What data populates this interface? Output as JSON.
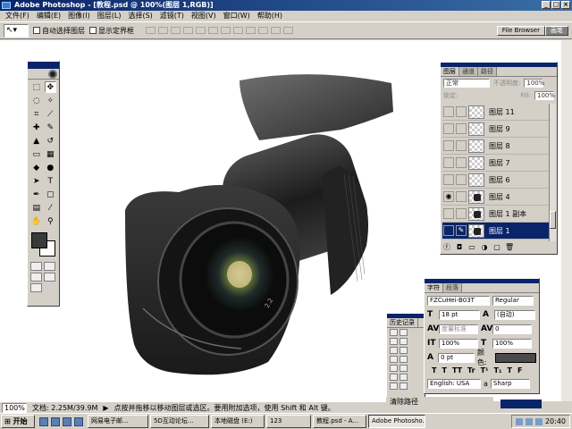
{
  "window": {
    "title": "Adobe Photoshop - [教程.psd @ 100%(图层 1,RGB)]",
    "controls": [
      "_",
      "□",
      "×"
    ]
  },
  "menu": [
    "文件(F)",
    "编辑(E)",
    "图像(I)",
    "图层(L)",
    "选择(S)",
    "滤镜(T)",
    "视图(V)",
    "窗口(W)",
    "帮助(H)"
  ],
  "options": {
    "auto_select": "自动选择图层",
    "show_bounds": "显示定界框"
  },
  "palette_well": [
    "File Browser",
    "画笔"
  ],
  "layers_panel": {
    "tabs": [
      "图层",
      "通道",
      "路径"
    ],
    "blend_mode": "正常",
    "opacity_label": "不透明度:",
    "opacity": "100%",
    "lock_label": "锁定:",
    "fill_label": "Fill:",
    "fill": "100%",
    "layers": [
      {
        "name": "图层 11",
        "thumb": "transparent"
      },
      {
        "name": "图层 9",
        "thumb": "transparent"
      },
      {
        "name": "图层 8",
        "thumb": "transparent"
      },
      {
        "name": "图层 7",
        "thumb": "transparent"
      },
      {
        "name": "图层 6",
        "thumb": "transparent"
      },
      {
        "name": "图层 4",
        "thumb": "object"
      },
      {
        "name": "图层 1 副本",
        "thumb": "object"
      },
      {
        "name": "图层 1",
        "thumb": "object",
        "selected": true
      }
    ]
  },
  "character_panel": {
    "tabs": [
      "字符",
      "段落"
    ],
    "font_family": "FZCuHei-B03T",
    "font_style": "Regular",
    "size": "18 pt",
    "leading": "(自动)",
    "kerning": "度量标准",
    "tracking": "0",
    "vscale": "100%",
    "hscale": "100%",
    "baseline": "0 pt",
    "color_label": "颜色:",
    "styles": [
      "T",
      "T",
      "TT",
      "Tr",
      "T¹",
      "T₁",
      "T",
      "F"
    ],
    "language": "English: USA",
    "antialias_prefix": "a",
    "antialias": "Sharp"
  },
  "history_panel": {
    "title": "历史记录"
  },
  "path_panel_label": "清除路径",
  "status": {
    "zoom": "100%",
    "doc": "文档: 2.25M/39.9M",
    "hint": "点按并拖移以移动图层或选区。要用附加选项，使用 Shift 和 Alt 键。"
  },
  "taskbar": {
    "start": "开始",
    "tasks": [
      "网易电子邮...",
      "5D互动论坛...",
      "本地磁盘 (E:)",
      "123",
      "教程.psd - A...",
      "Adobe Photosho..."
    ],
    "active_task": 5,
    "clock": "20:40"
  },
  "lens_label": "2.2"
}
